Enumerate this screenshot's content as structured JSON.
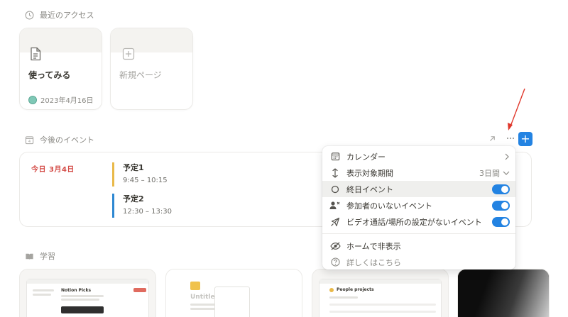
{
  "recent": {
    "label": "最近のアクセス",
    "cards": [
      {
        "title": "使ってみる",
        "date": "2023年4月16日"
      },
      {
        "title": "新規ページ"
      }
    ]
  },
  "events": {
    "label": "今後のイベント",
    "calendar_day": "4",
    "today_label": "今日 3月4日",
    "items": [
      {
        "title": "予定1",
        "time": "9:45 – 10:15",
        "color": "#e9b949"
      },
      {
        "title": "予定2",
        "time": "12:30 – 13:30",
        "color": "#2e88d2"
      }
    ]
  },
  "menu": {
    "calendar": "カレンダー",
    "range_label": "表示対象期間",
    "range_value": "3日間",
    "all_day": "終日イベント",
    "no_attendees": "参加者のいないイベント",
    "no_video": "ビデオ通話/場所の設定がないイベント",
    "hide_home": "ホームで非表示",
    "learn_more": "詳しくはこちら"
  },
  "learning": {
    "label": "学習",
    "mock1": {
      "heading": "Notion Picks"
    },
    "mock2": {
      "heading": "Untitled"
    },
    "mock3": {
      "heading": "People projects"
    }
  },
  "colors": {
    "accent": "#2383e2",
    "today": "#d44c47",
    "annotation": "#e0382c"
  }
}
